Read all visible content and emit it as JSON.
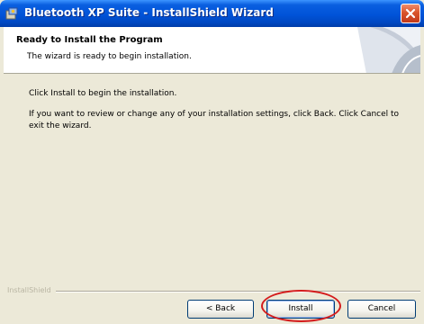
{
  "window": {
    "title": "Bluetooth XP Suite - InstallShield Wizard",
    "title_icon": "installer-icon",
    "close_icon": "close-icon"
  },
  "header": {
    "title": "Ready to Install the Program",
    "subtitle": "The wizard is ready to begin installation."
  },
  "body": {
    "instruction": "Click Install to begin the installation.",
    "review_note": "If you want to review or change any of your installation settings, click Back. Click Cancel to exit the wizard."
  },
  "footer": {
    "brand": "InstallShield",
    "buttons": {
      "back": "< Back",
      "install": "Install",
      "cancel": "Cancel"
    }
  },
  "colors": {
    "titlebar_blue": "#0053d8",
    "window_bg": "#ece9d8",
    "highlight_ring": "#d41c1c",
    "close_red": "#d9542a"
  }
}
